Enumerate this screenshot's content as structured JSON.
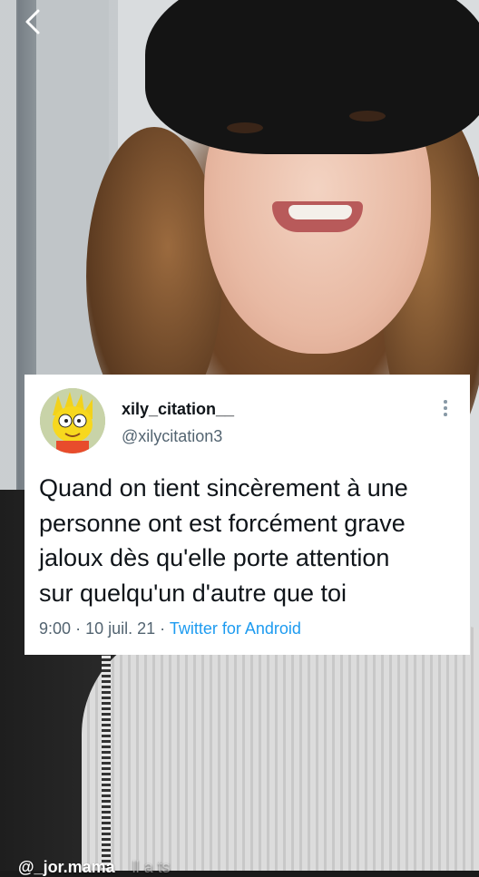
{
  "nav": {
    "back_icon": "chevron-left-icon"
  },
  "tweet": {
    "display_name": "xily_citation__",
    "handle": "@xilycitation3",
    "text": "Quand on tient sincèrement à une\npersonne ont est forcément grave\njaloux dès qu'elle porte attention\nsur quelqu'un d'autre que toi",
    "time": "9:00",
    "separator": "·",
    "date": "10 juil. 21",
    "source": "Twitter for Android",
    "avatar_icon": "cartoon-avatar-icon",
    "more_icon": "more-vertical-icon"
  },
  "overlay": {
    "username": "@_jor.mama",
    "faded_text": "ll a ts"
  },
  "colors": {
    "card_background": "#ffffff",
    "text_primary": "#0f1419",
    "text_secondary": "#536471",
    "link": "#1d9bf0"
  }
}
